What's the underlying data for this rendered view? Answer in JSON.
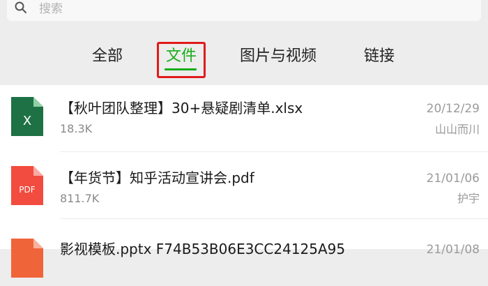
{
  "search": {
    "placeholder": "搜索"
  },
  "tabs": [
    {
      "label": "全部"
    },
    {
      "label": "文件"
    },
    {
      "label": "图片与视频"
    },
    {
      "label": "链接"
    }
  ],
  "active_tab": "文件",
  "files": [
    {
      "icon_label": "X",
      "icon_color": "#1e7145",
      "name": "【秋叶团队整理】30+悬疑剧清单.xlsx",
      "size": "18.3K",
      "date": "20/12/29",
      "sender": "山山而川"
    },
    {
      "icon_label": "PDF",
      "icon_color": "#f24b3f",
      "name": "【年货节】知乎活动宣讲会.pdf",
      "size": "811.7K",
      "date": "21/01/06",
      "sender": "护宇"
    },
    {
      "icon_label": "",
      "icon_color": "#f0643a",
      "name": "影视模板.pptx F74B53B06E3CC24125A95",
      "size": "",
      "date": "21/01/08",
      "sender": ""
    }
  ],
  "colors": {
    "accent": "#1aad19",
    "highlight": "#e01b1b"
  }
}
